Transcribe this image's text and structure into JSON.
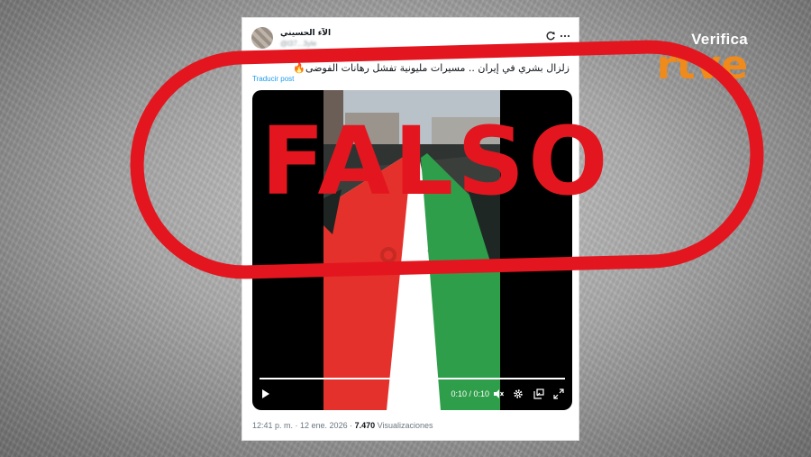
{
  "brand": {
    "verifica": "Verifica",
    "rtve": "rtve",
    "accent": "#f08a1a"
  },
  "post": {
    "username": "الآء الحسيني",
    "handle": "@l37...3yle",
    "text": "زلزال بشري في إيران .. مسيرات مليونية تفشل رهانات الفوضى🔥",
    "translate_label": "Traducir post",
    "timestamp": "12:41 p. m. · 12 ene. 2026 · ",
    "views_count": "7.470",
    "views_label": " Visualizaciones"
  },
  "video": {
    "time": "0:10 / 0:10",
    "progress": 1.0,
    "icons": [
      "play-icon",
      "volume-icon",
      "settings-icon",
      "pip-icon",
      "fullscreen-icon"
    ]
  },
  "stamp": {
    "text": "FALSO",
    "color": "#e3161f"
  }
}
